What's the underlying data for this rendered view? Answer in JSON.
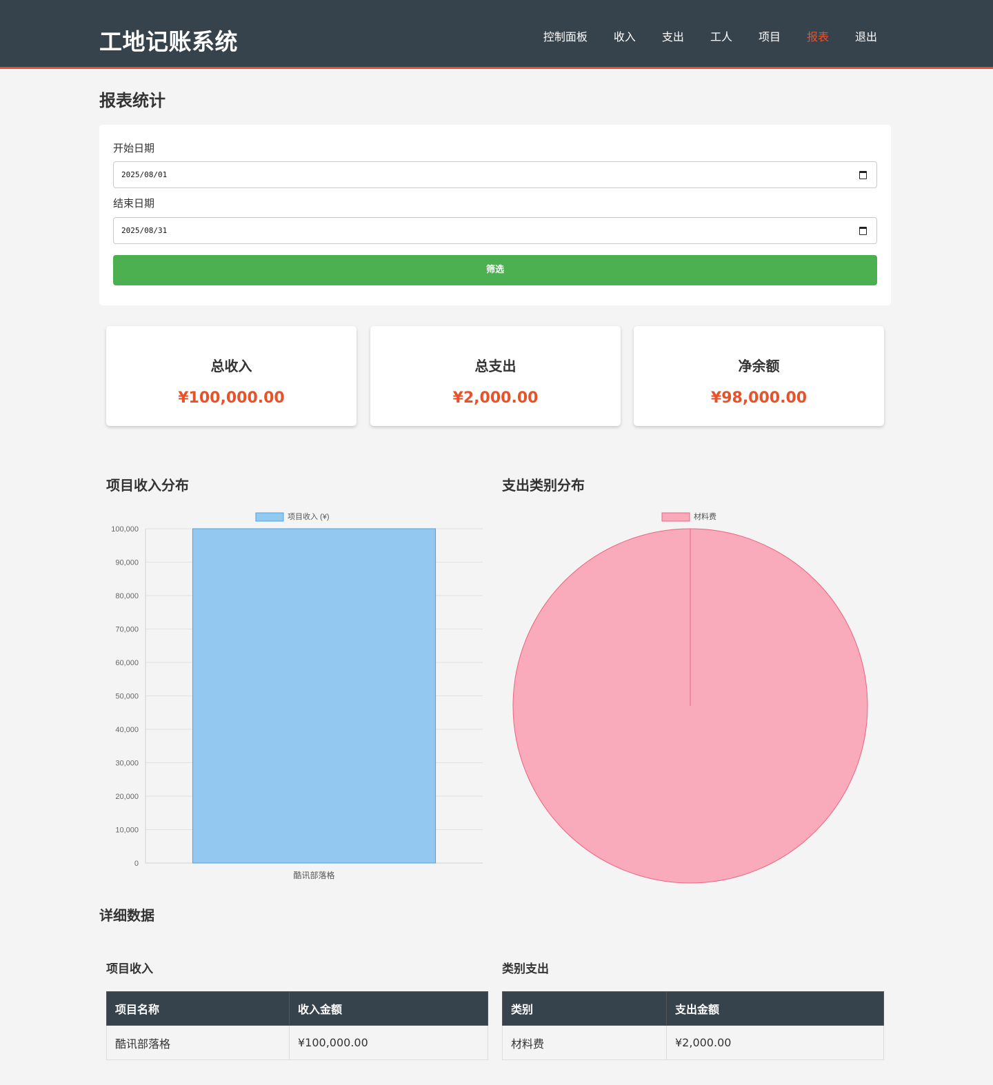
{
  "app": {
    "brand": "工地记账系统"
  },
  "nav": {
    "items": [
      "控制面板",
      "收入",
      "支出",
      "工人",
      "项目",
      "报表",
      "退出"
    ],
    "active_index": 5,
    "active_color": "#e8522a"
  },
  "page": {
    "title": "报表统计"
  },
  "filter": {
    "start_label": "开始日期",
    "start_value": "2025/08/01",
    "end_label": "结束日期",
    "end_value": "2025/08/31",
    "button_label": "筛选"
  },
  "summary": [
    {
      "label": "总收入",
      "value": "¥100,000.00"
    },
    {
      "label": "总支出",
      "value": "¥2,000.00"
    },
    {
      "label": "净余额",
      "value": "¥98,000.00"
    }
  ],
  "charts": {
    "income_title": "项目收入分布",
    "expense_title": "支出类别分布"
  },
  "chart_data": [
    {
      "type": "bar",
      "categories": [
        "酷讯部落格"
      ],
      "series": [
        {
          "name": "项目收入 (¥)",
          "values": [
            100000
          ],
          "color": "#93c9f0",
          "border": "#4aa3e6"
        }
      ],
      "ylim": [
        0,
        100000
      ],
      "yticks": [
        "100,000",
        "90,000",
        "80,000",
        "70,000",
        "60,000",
        "50,000",
        "40,000",
        "30,000",
        "20,000",
        "10,000",
        "0"
      ],
      "grid": true,
      "legend": "top"
    },
    {
      "type": "pie",
      "categories": [
        "材料费"
      ],
      "values": [
        2000
      ],
      "colors": [
        "#f9aabb"
      ],
      "border": "#f0637f",
      "legend": "top"
    }
  ],
  "details": {
    "title": "详细数据",
    "income": {
      "title": "项目收入",
      "headers": [
        "项目名称",
        "收入金额"
      ],
      "rows": [
        [
          "酷讯部落格",
          "¥100,000.00"
        ]
      ]
    },
    "expense": {
      "title": "类别支出",
      "headers": [
        "类别",
        "支出金额"
      ],
      "rows": [
        [
          "材料费",
          "¥2,000.00"
        ]
      ]
    }
  }
}
